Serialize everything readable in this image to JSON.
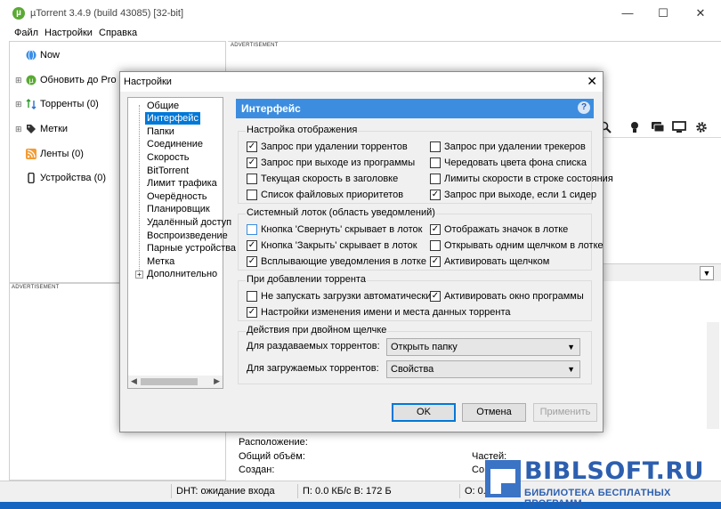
{
  "window": {
    "title": "µTorrent 3.4.9  (build 43085) [32-bit]",
    "logo": "µ",
    "min": "—",
    "max": "☐",
    "close": "✕"
  },
  "menu": [
    "Файл",
    "Настройки",
    "Справка"
  ],
  "sidebar": {
    "items": [
      {
        "label": "Now",
        "icon": "globe-icon",
        "expander": ""
      },
      {
        "label": "Обновить до Pro",
        "icon": "utorrent-icon",
        "expander": "⊞"
      },
      {
        "label": "Торренты (0)",
        "icon": "arrows-icon",
        "expander": "⊞"
      },
      {
        "label": "Метки",
        "icon": "tag-icon",
        "expander": "⊞"
      },
      {
        "label": "Ленты (0)",
        "icon": "rss-icon",
        "expander": ""
      },
      {
        "label": "Устройства (0)",
        "icon": "device-icon",
        "expander": ""
      }
    ]
  },
  "ads": {
    "top": "ADVERTISEMENT",
    "left": "ADVERTISEMENT"
  },
  "toolbar_icons": [
    "search-icon",
    "bulb-icon",
    "chat-icon",
    "monitor-icon",
    "gear-icon"
  ],
  "info": {
    "location": "Расположение:",
    "total_size": "Общий объём:",
    "created": "Создан:",
    "pieces": "Частей:",
    "co": "Со"
  },
  "status": {
    "dht": "DHT: ожидание входа",
    "down": "П: 0.0 КБ/с В: 172 Б",
    "up": "О: 0."
  },
  "watermark": {
    "name": "BIBLSOFT.RU",
    "sub": "БИБЛИОТЕКА БЕСПЛАТНЫХ ПРОГРАММ"
  },
  "dialog": {
    "title": "Настройки",
    "close": "✕",
    "tree": [
      "Общие",
      "Интерфейс",
      "Папки",
      "Соединение",
      "Скорость",
      "BitTorrent",
      "Лимит трафика",
      "Очерёдность",
      "Планировщик",
      "Удалённый доступ",
      "Воспроизведение",
      "Парные устройства",
      "Метка",
      "Дополнительно"
    ],
    "panel_title": "Интерфейс",
    "help": "?",
    "groups": {
      "display": {
        "title": "Настройка отображения",
        "left": [
          {
            "label": "Запрос при удалении торрентов",
            "checked": true
          },
          {
            "label": "Запрос при выходе из программы",
            "checked": true
          },
          {
            "label": "Текущая скорость в заголовке",
            "checked": false
          },
          {
            "label": "Список файловых приоритетов",
            "checked": false
          }
        ],
        "right": [
          {
            "label": "Запрос при удалении трекеров",
            "checked": false
          },
          {
            "label": "Чередовать цвета фона списка",
            "checked": false
          },
          {
            "label": "Лимиты скорости в строке состояния",
            "checked": false
          },
          {
            "label": "Запрос при выходе, если 1 сидер",
            "checked": true
          }
        ]
      },
      "tray": {
        "title": "Системный лоток (область уведомлений)",
        "left": [
          {
            "label": "Кнопка 'Свернуть' скрывает в лоток",
            "checked": false
          },
          {
            "label": "Кнопка 'Закрыть' скрывает в лоток",
            "checked": true
          },
          {
            "label": "Всплывающие уведомления в лотке",
            "checked": true
          }
        ],
        "right": [
          {
            "label": "Отображать значок в лотке",
            "checked": true
          },
          {
            "label": "Открывать одним щелчком в лотке",
            "checked": false
          },
          {
            "label": "Активировать щелчком",
            "checked": true
          }
        ]
      },
      "adding": {
        "title": "При добавлении торрента",
        "left": [
          {
            "label": "Не запускать загрузки автоматически",
            "checked": false
          },
          {
            "label": "Настройки изменения имени и места данных торрента",
            "checked": true
          }
        ],
        "right": [
          {
            "label": "Активировать окно программы",
            "checked": true
          }
        ]
      },
      "dblclick": {
        "title": "Действия при двойном щелчке",
        "seeding_label": "Для раздаваемых торрентов:",
        "seeding_value": "Открыть папку",
        "downloading_label": "Для загружаемых торрентов:",
        "downloading_value": "Свойства"
      }
    },
    "buttons": {
      "ok": "OK",
      "cancel": "Отмена",
      "apply": "Применить"
    }
  }
}
